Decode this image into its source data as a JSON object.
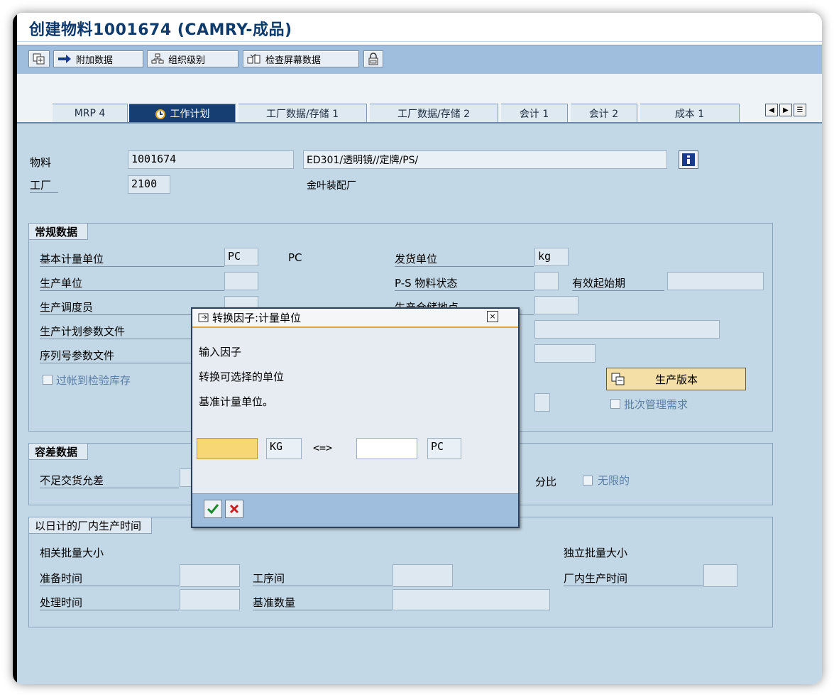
{
  "window": {
    "title": "创建物料1001674 (CAMRY-成品)"
  },
  "toolbar": {
    "additional_data": "附加数据",
    "org_levels": "组织级别",
    "check_screen_data": "检查屏幕数据"
  },
  "tabs": [
    {
      "label": "MRP 4"
    },
    {
      "label": "工作计划",
      "active": true
    },
    {
      "label": "工厂数据/存储 1"
    },
    {
      "label": "工厂数据/存储 2"
    },
    {
      "label": "会计 1"
    },
    {
      "label": "会计 2"
    },
    {
      "label": "成本 1"
    }
  ],
  "header": {
    "material_label": "物料",
    "material_value": "1001674",
    "material_desc": "ED301/透明镜//定牌/PS/",
    "plant_label": "工厂",
    "plant_value": "2100",
    "plant_name": "金叶装配厂"
  },
  "general": {
    "title": "常规数据",
    "base_uom_label": "基本计量单位",
    "base_uom_value": "PC",
    "base_uom_text": "PC",
    "issue_unit_label": "发货单位",
    "issue_unit_value": "kg",
    "prod_unit_label": "生产单位",
    "ps_status_label": "P-S 物料状态",
    "valid_from_label": "有效起始期",
    "scheduler_label": "生产调度员",
    "storage_loc_label": "生产仓储地点",
    "prod_profile_label": "生产计划参数文件",
    "serial_profile_label": "序列号参数文件",
    "post_qi_label": "过帐到检验库存",
    "prod_version_btn": "生产版本",
    "batch_req_label": "批次管理需求"
  },
  "tolerance": {
    "title": "容差数据",
    "under_label": "不足交货允差",
    "percent_label": "分比",
    "unlimited_label": "无限的"
  },
  "inhouse": {
    "title": "以日计的厂内生产时间",
    "lot_dep_label": "相关批量大小",
    "lot_indep_label": "独立批量大小",
    "setup_label": "准备时间",
    "interop_label": "工序间",
    "inhouse_time_label": "厂内生产时间",
    "processing_label": "处理时间",
    "base_qty_label": "基准数量"
  },
  "dialog": {
    "title": "转换因子:计量单位",
    "line1": "输入因子",
    "line2": "转换可选择的单位",
    "line3": "基准计量单位。",
    "input_value": "",
    "unit_left": "KG",
    "equiv": "<=>",
    "unit_right": "PC"
  },
  "colors": {
    "accent": "#173e72",
    "toolbar": "#9fbedd",
    "input_focus": "#f7d774"
  }
}
